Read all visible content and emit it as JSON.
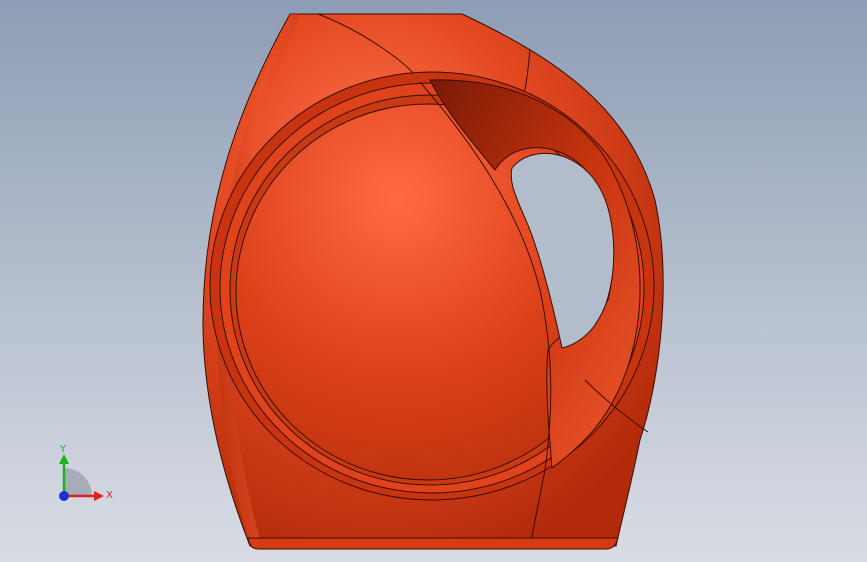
{
  "viewport": {
    "background_top": "#8e9db5",
    "background_bottom": "#d9dce4"
  },
  "model": {
    "body_color": "#e0431c",
    "highlight_color": "#ff6f4a",
    "shadow_color": "#8a1c06",
    "edge_color": "#3a0d02"
  },
  "triad": {
    "x_label": "X",
    "y_label": "Y",
    "x_color": "#e02020",
    "y_color": "#20b020",
    "z_color": "#2030d0"
  }
}
